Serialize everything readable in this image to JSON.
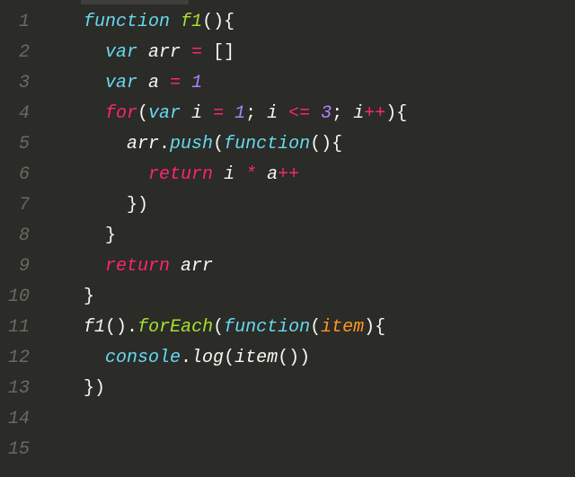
{
  "gutter": [
    "1",
    "2",
    "3",
    "4",
    "5",
    "6",
    "7",
    "8",
    "9",
    "10",
    "11",
    "12",
    "13",
    "14",
    "15"
  ],
  "tok": {
    "function": "function",
    "var": "var",
    "for": "for",
    "return": "return",
    "f1": "f1",
    "arr": "arr",
    "a": "a",
    "i": "i",
    "push": "push",
    "forEach": "forEach",
    "console": "console",
    "log": "log",
    "item": "item",
    "eq": " = ",
    "brackets": "[]",
    "one": "1",
    "three": "3",
    "lparen": "(",
    "rparen": ")",
    "lbrace": "{",
    "rbrace": "}",
    "rparenrbrace": "){",
    "rbracerparen": "})",
    "emptyparens": "()",
    "emptyparensbrace": "(){",
    "emptyparensrparen": "())",
    "semi": "; ",
    "lte": " <= ",
    "plusplus": "++",
    "star": " * ",
    "dot": "."
  },
  "indent": {
    "i1": "    ",
    "i2": "      ",
    "i3": "        ",
    "i4": "          "
  }
}
